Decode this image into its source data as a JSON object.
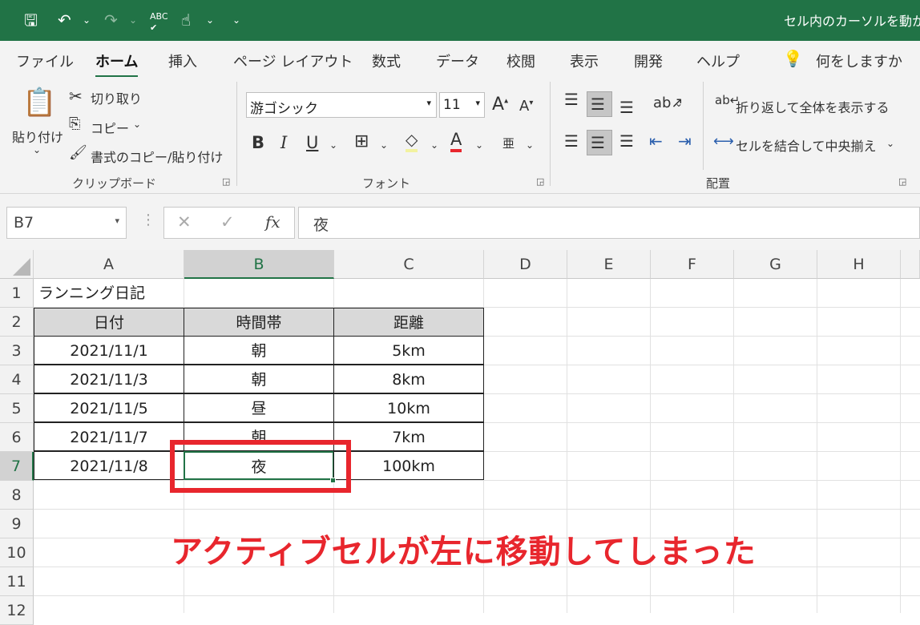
{
  "window": {
    "title": "セル内のカーソルを動か"
  },
  "tabs": [
    "ファイル",
    "ホーム",
    "挿入",
    "ページ レイアウト",
    "数式",
    "データ",
    "校閲",
    "表示",
    "開発",
    "ヘルプ"
  ],
  "tell_me": "何をしますか",
  "clipboard": {
    "paste": "貼り付け",
    "cut": "切り取り",
    "copy": "コピー",
    "format_painter": "書式のコピー/貼り付け",
    "group_label": "クリップボード"
  },
  "font": {
    "name": "游ゴシック",
    "size": "11",
    "group_label": "フォント",
    "bold": "B",
    "italic": "I",
    "underline": "U",
    "font_color": "A",
    "phonetic": "亜"
  },
  "alignment": {
    "wrap_text": "折り返して全体を表示する",
    "merge_center": "セルを結合して中央揃え",
    "group_label": "配置"
  },
  "formula_bar": {
    "name_box": "B7",
    "content": "夜",
    "fx": "fx"
  },
  "sheet": {
    "columns": [
      "A",
      "B",
      "C",
      "D",
      "E",
      "F",
      "G",
      "H"
    ],
    "rows": [
      "1",
      "2",
      "3",
      "4",
      "5",
      "6",
      "7",
      "8",
      "9",
      "10",
      "11",
      "12"
    ],
    "A1": "ランニング日記",
    "headers": [
      "日付",
      "時間帯",
      "距離"
    ],
    "data": [
      [
        "2021/11/1",
        "朝",
        "5km"
      ],
      [
        "2021/11/3",
        "朝",
        "8km"
      ],
      [
        "2021/11/5",
        "昼",
        "10km"
      ],
      [
        "2021/11/7",
        "朝",
        "7km"
      ],
      [
        "2021/11/8",
        "夜",
        "100km"
      ]
    ]
  },
  "annotation": "アクティブセルが左に移動してしまった",
  "colors": {
    "accent": "#217346",
    "highlight": "#e8262d"
  }
}
